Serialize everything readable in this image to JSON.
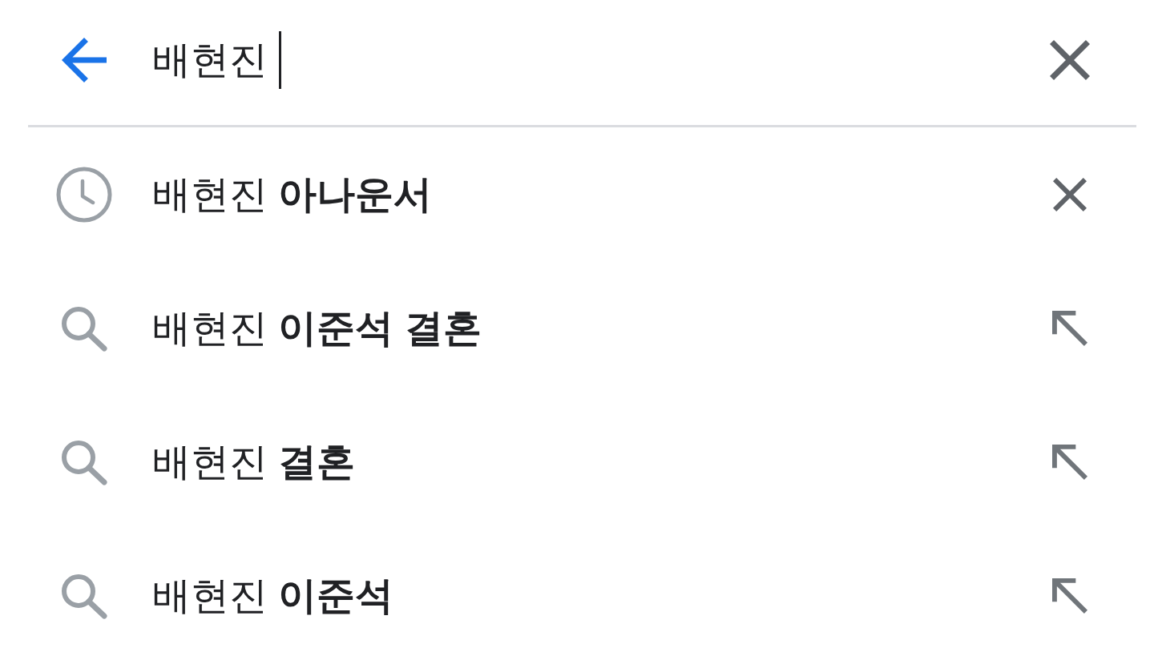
{
  "search_bar": {
    "value": "배현진",
    "focused": true
  },
  "suggestions": [
    {
      "kind": "history",
      "text": "배현진 **아나운서**"
    },
    {
      "kind": "query",
      "text": "배현진 **이준석 결혼**"
    },
    {
      "kind": "query",
      "text": "배현진 **결혼**"
    },
    {
      "kind": "query",
      "text": "배현진 **이준석**"
    }
  ]
}
